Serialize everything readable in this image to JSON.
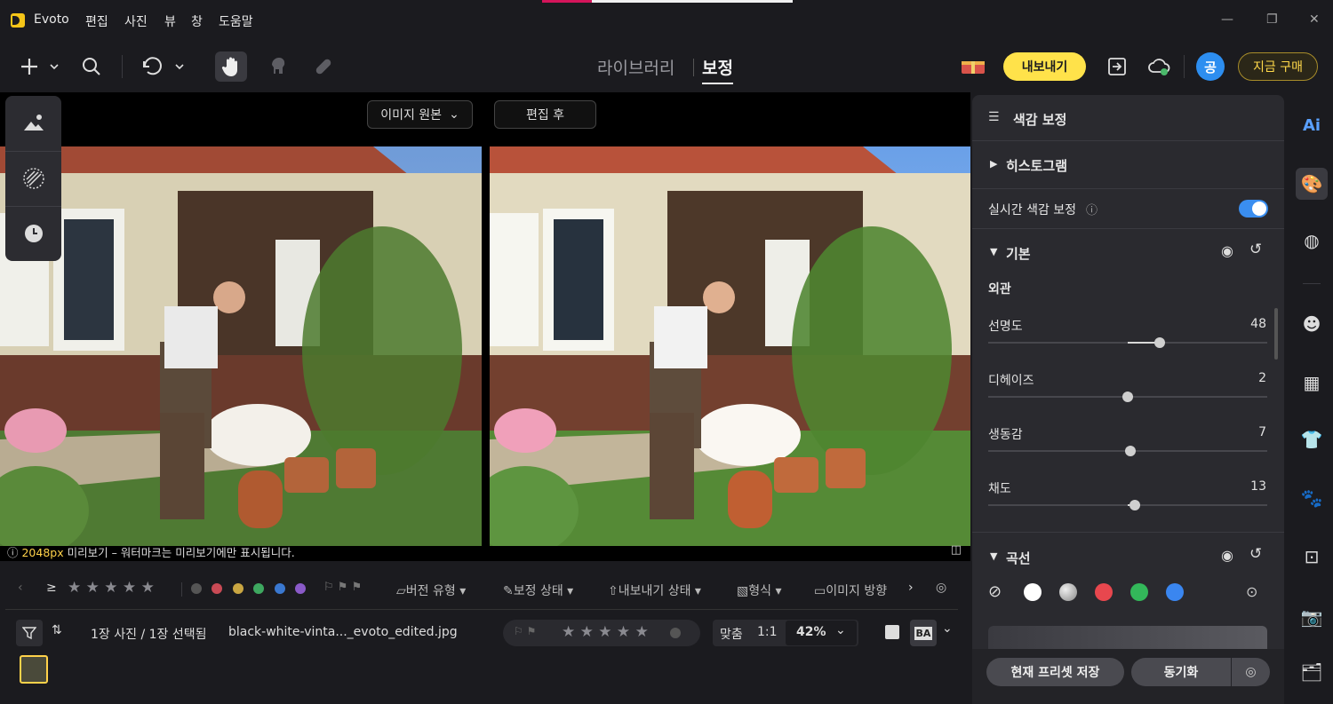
{
  "app": {
    "name": "Evoto",
    "menus": [
      "편집",
      "사진",
      "뷰",
      "창",
      "도움말"
    ]
  },
  "topbar": {
    "tabs": {
      "library": "라이브러리",
      "edit": "보정"
    },
    "export_label": "내보내기",
    "avatar_initial": "공",
    "buy_label": "지금 구매"
  },
  "compare": {
    "original_label": "이미지 원본",
    "edited_label": "편집 후"
  },
  "preview_note": {
    "size": "2048px",
    "text": " 미리보기 – 워터마크는 미리보기에만 표시됩니다."
  },
  "filterbar": {
    "version_type": "버전 유형",
    "edit_status": "보정 상태",
    "export_status": "내보내기 상태",
    "format": "형식",
    "orientation": "이미지 방향",
    "label_colors": [
      "#c94a55",
      "#c9a642",
      "#3ea860",
      "#3a78d0",
      "#8a5ac8"
    ]
  },
  "statusbar": {
    "count": "1장 사진 / 1장 선택됨",
    "filename": "black-white-vinta..._evoto_edited.jpg",
    "fit": "맞춤",
    "one_to_one": "1:1",
    "zoom": "42%",
    "ba": "BA"
  },
  "panel": {
    "title": "색감 보정",
    "histogram": "히스토그램",
    "realtime": "실시간 색감 보정",
    "realtime_on": true,
    "basic": "기본",
    "appearance": "외관",
    "sliders": [
      {
        "label": "선명도",
        "value": "48",
        "level": 0.23
      },
      {
        "label": "디헤이즈",
        "value": "2",
        "level": 0.0
      },
      {
        "label": "생동감",
        "value": "7",
        "level": 0.02
      },
      {
        "label": "채도",
        "value": "13",
        "level": 0.05
      }
    ],
    "curve": "곡선",
    "curve_colors": [
      "#ffffff",
      "#b8b8b8",
      "#e8474e",
      "#33b85a",
      "#3a86f0"
    ],
    "save_preset": "현재 프리셋 저장",
    "sync": "동기화"
  }
}
